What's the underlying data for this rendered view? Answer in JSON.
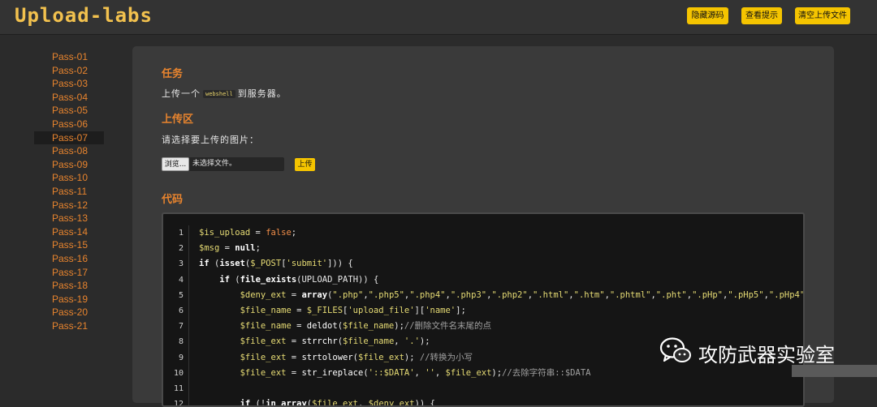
{
  "app": {
    "logo_text": "Upload-labs"
  },
  "header": {
    "buttons": [
      "隐藏源码",
      "查看提示",
      "清空上传文件"
    ]
  },
  "sidebar": {
    "active_index": 6,
    "items": [
      "Pass-01",
      "Pass-02",
      "Pass-03",
      "Pass-04",
      "Pass-05",
      "Pass-06",
      "Pass-07",
      "Pass-08",
      "Pass-09",
      "Pass-10",
      "Pass-11",
      "Pass-12",
      "Pass-13",
      "Pass-14",
      "Pass-15",
      "Pass-16",
      "Pass-17",
      "Pass-18",
      "Pass-19",
      "Pass-20",
      "Pass-21"
    ]
  },
  "task": {
    "heading": "任务",
    "text_before": "上传一个",
    "code_word": "webshell",
    "text_after": "到服务器。"
  },
  "upload": {
    "heading": "上传区",
    "prompt": "请选择要上传的图片：",
    "browse_label": "浏览...",
    "no_file_text": "未选择文件。",
    "submit_label": "上传"
  },
  "code": {
    "heading": "代码",
    "line_numbers": [
      "1",
      "2",
      "3",
      "4",
      "5",
      "6",
      "7",
      "8",
      "9",
      "10",
      "11",
      "12"
    ]
  },
  "watermark": {
    "text": "攻防武器实验室"
  },
  "colors": {
    "accent": "#e8842e",
    "button_yellow": "#f5c400",
    "background": "#2b2b2b",
    "panel": "#3a3a3a"
  }
}
